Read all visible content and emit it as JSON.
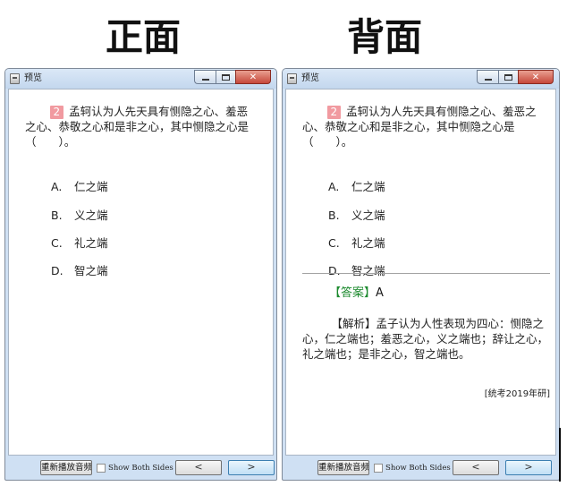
{
  "labels": {
    "front": "正面",
    "back": "背面"
  },
  "window": {
    "title": "预览",
    "close_glyph": "✕",
    "minimize_icon": "minimize-icon",
    "maximize_icon": "maximize-icon"
  },
  "question": {
    "number": "2",
    "stem": "孟轲认为人先天具有恻隐之心、羞恶之心、恭敬之心和是非之心，其中恻隐之心是（　　）。",
    "options": [
      {
        "letter": "A.",
        "text": "仁之端"
      },
      {
        "letter": "B.",
        "text": "义之端"
      },
      {
        "letter": "C.",
        "text": "礼之端"
      },
      {
        "letter": "D.",
        "text": "智之端"
      }
    ]
  },
  "answer": {
    "tag": "【答案】",
    "value": "A"
  },
  "analysis": {
    "tag": "【解析】",
    "text": "孟子认为人性表现为四心：恻隐之心，仁之端也；羞恶之心，义之端也；辞让之心，礼之端也；是非之心，智之端也。"
  },
  "source": "[统考2019年研]",
  "bottombar": {
    "replay_label": "重新播放音频",
    "show_both_label": "Show Both Sides",
    "prev_glyph": "<",
    "next_glyph": ">"
  },
  "colors": {
    "qnum_bg": "#f19aa0",
    "answer_tag": "#1c8a2e",
    "close_btn": "#c6473a",
    "frame": "#cfe0f3"
  }
}
